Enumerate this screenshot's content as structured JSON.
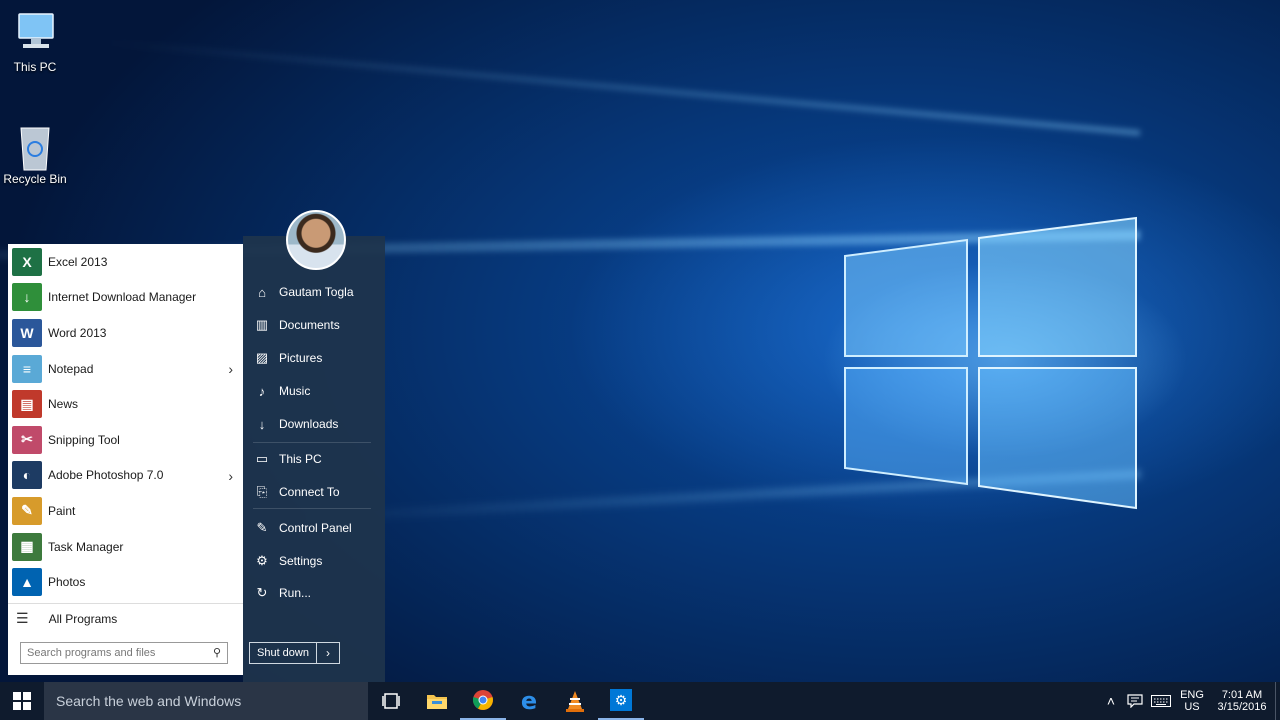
{
  "desktop": {
    "icons": [
      {
        "label": "This PC"
      },
      {
        "label": "Recycle Bin"
      }
    ]
  },
  "start_menu": {
    "apps": [
      {
        "label": "Excel 2013",
        "icon": "excel-icon",
        "submenu": false
      },
      {
        "label": "Internet Download Manager",
        "icon": "idm-icon",
        "submenu": false
      },
      {
        "label": "Word 2013",
        "icon": "word-icon",
        "submenu": false
      },
      {
        "label": "Notepad",
        "icon": "notepad-icon",
        "submenu": true
      },
      {
        "label": "News",
        "icon": "news-icon",
        "submenu": false
      },
      {
        "label": "Snipping Tool",
        "icon": "snipping-tool-icon",
        "submenu": false
      },
      {
        "label": "Adobe Photoshop 7.0",
        "icon": "photoshop-icon",
        "submenu": true
      },
      {
        "label": "Paint",
        "icon": "paint-icon",
        "submenu": false
      },
      {
        "label": "Task Manager",
        "icon": "task-manager-icon",
        "submenu": false
      },
      {
        "label": "Photos",
        "icon": "photos-icon",
        "submenu": false
      }
    ],
    "all_programs": "All Programs",
    "search_placeholder": "Search programs and files",
    "user_name": "Gautam Togla",
    "right_items": [
      {
        "label": "Gautam Togla",
        "icon": "user-folder-icon"
      },
      {
        "label": "Documents",
        "icon": "documents-icon"
      },
      {
        "label": "Pictures",
        "icon": "pictures-icon"
      },
      {
        "label": "Music",
        "icon": "music-icon"
      },
      {
        "label": "Downloads",
        "icon": "downloads-icon"
      },
      {
        "label": "This PC",
        "icon": "this-pc-icon"
      },
      {
        "label": "Connect To",
        "icon": "connect-to-icon"
      },
      {
        "label": "Control Panel",
        "icon": "control-panel-icon"
      },
      {
        "label": "Settings",
        "icon": "settings-icon"
      },
      {
        "label": "Run...",
        "icon": "run-icon"
      }
    ],
    "shutdown_label": "Shut down",
    "shutdown_arrow": "›"
  },
  "taskbar": {
    "search_text": "Search the web and Windows",
    "pinned": [
      "task-view-icon",
      "file-explorer-icon",
      "chrome-icon",
      "edge-icon",
      "vlc-icon",
      "settings-app-icon"
    ],
    "tray": {
      "language": "ENG",
      "region": "US",
      "time": "7:01 AM",
      "date": "3/15/2016"
    }
  },
  "colors": {
    "accent": "#0078d7",
    "start_panel": "#1e344c",
    "taskbar": "#0f1b2d"
  }
}
